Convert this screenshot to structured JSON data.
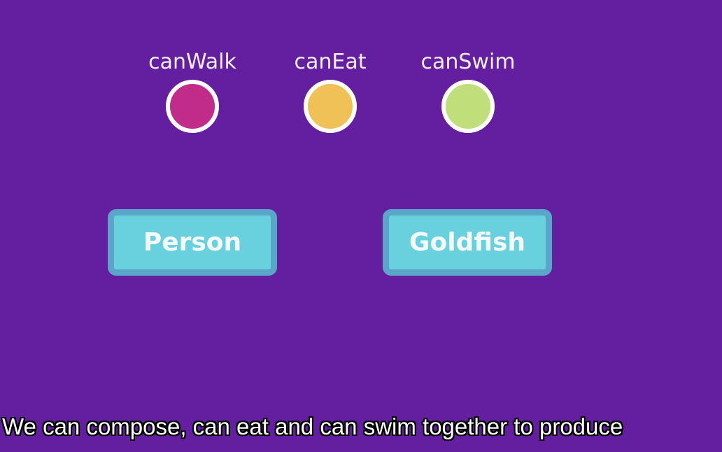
{
  "colors": {
    "background": "#631fa0",
    "canWalk": "#c12b89",
    "canEat": "#efc156",
    "canSwim": "#c0df7a",
    "box_fill": "#69d1dd",
    "box_border": "#5ba6c8"
  },
  "traits": [
    {
      "label": "canWalk",
      "color_name": "magenta"
    },
    {
      "label": "canEat",
      "color_name": "yellow"
    },
    {
      "label": "canSwim",
      "color_name": "light-green"
    }
  ],
  "classes": [
    {
      "label": "Person"
    },
    {
      "label": "Goldfish"
    }
  ],
  "subtitle": "We can compose, can eat and can swim together to produce"
}
